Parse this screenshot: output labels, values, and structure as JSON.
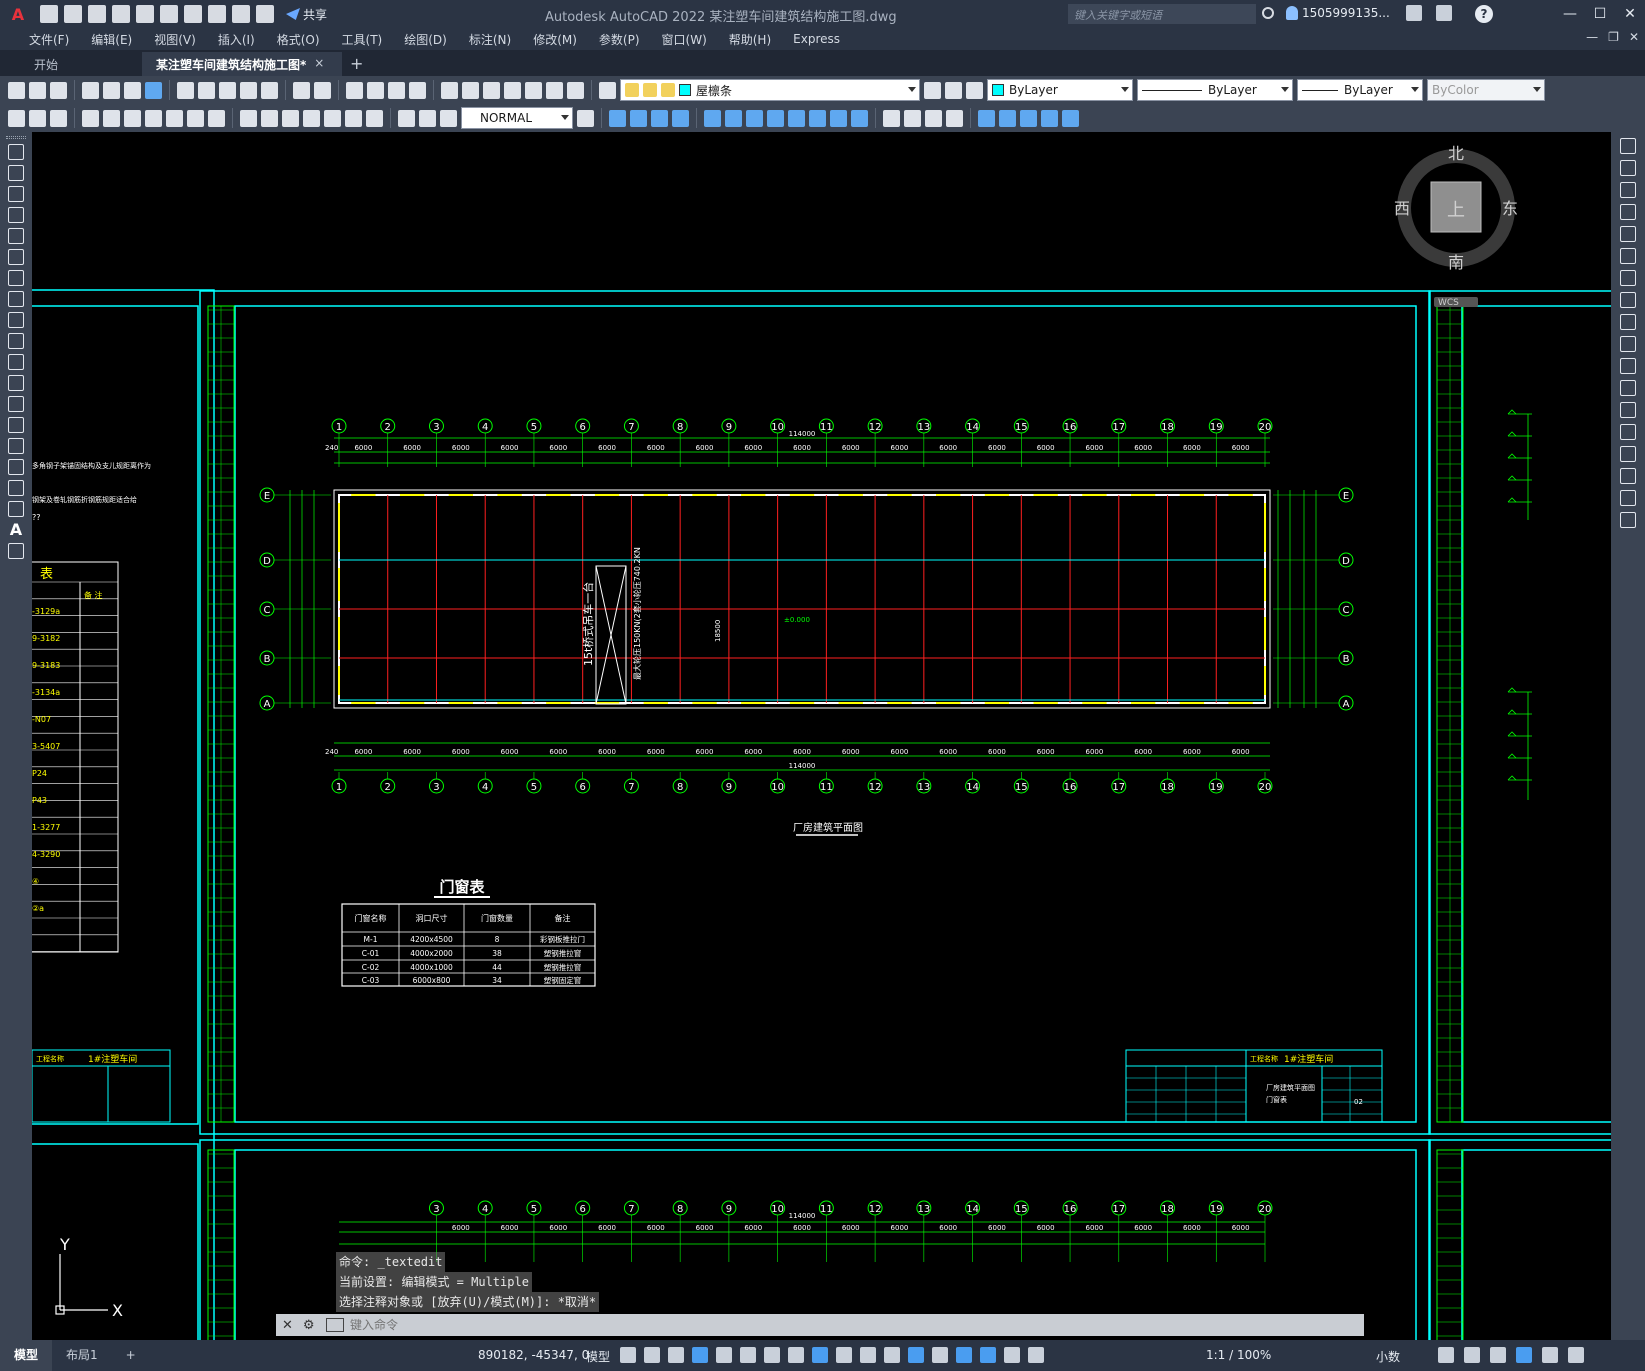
{
  "app": {
    "title": "Autodesk AutoCAD 2022    某注塑车间建筑结构施工图.dwg",
    "logo": "A",
    "share_label": "共享",
    "search_placeholder": "键入关键字或短语",
    "user": "1505999135...",
    "window_controls": [
      "—",
      "☐",
      "✕"
    ]
  },
  "menus": [
    "文件(F)",
    "编辑(E)",
    "视图(V)",
    "插入(I)",
    "格式(O)",
    "工具(T)",
    "绘图(D)",
    "标注(N)",
    "修改(M)",
    "参数(P)",
    "窗口(W)",
    "帮助(H)",
    "Express"
  ],
  "mdi_controls": [
    "—",
    "❐",
    "✕"
  ],
  "tabs": {
    "start": "开始",
    "active": "某注塑车间建筑结构施工图*",
    "close": "×",
    "new": "+"
  },
  "toolbar": {
    "layer": "屋檩条",
    "color": "ByLayer",
    "linetype": "ByLayer",
    "lineweight": "ByLayer",
    "plotstyle": "ByColor",
    "dimstyle": "NORMAL"
  },
  "viewcube": {
    "north": "北",
    "south": "南",
    "east": "东",
    "west": "西",
    "face": "上",
    "wcs": "WCS"
  },
  "ucs": {
    "x": "X",
    "y": "Y"
  },
  "drawing": {
    "plan_title": "厂房建筑平面图",
    "total_length": "114000",
    "bay": "6000",
    "side_dim": "240",
    "axis_numbers": [
      "1",
      "2",
      "3",
      "4",
      "5",
      "6",
      "7",
      "8",
      "9",
      "10",
      "11",
      "12",
      "13",
      "14",
      "15",
      "16",
      "17",
      "18",
      "19",
      "20"
    ],
    "axis_letters": [
      "E",
      "D",
      "C",
      "B",
      "A"
    ],
    "crane_note": "15t桥式吊车一台",
    "crane_load": "最大轮压150KN(2套小轮压740.2KN",
    "elevation": "±0.000",
    "span_label": "18500",
    "door_table": {
      "title": "门窗表",
      "headers": [
        "门窗名称",
        "洞口尺寸",
        "门窗数量",
        "备注"
      ],
      "rows": [
        [
          "M-1",
          "4200x4500",
          "8",
          "彩钢板推拉门"
        ],
        [
          "C-01",
          "4000x2000",
          "38",
          "塑钢推拉窗"
        ],
        [
          "C-02",
          "4000x1000",
          "44",
          "塑钢推拉窗"
        ],
        [
          "C-03",
          "6000x800",
          "34",
          "塑钢固定窗"
        ]
      ]
    },
    "title_block": {
      "project_label": "工程名称",
      "project": "1#注塑车间",
      "drawing_name": "厂房建筑平面图",
      "sub": "门窗表",
      "number": "02"
    },
    "left_table_title": "表",
    "left_table_note": "备 注",
    "left_codes": [
      "-3129a",
      "9-3182",
      "9-3183",
      "-3134a",
      "-N07",
      "3-5407",
      "P24",
      "P43",
      "1-3277",
      "4-3290",
      "④",
      "②a"
    ],
    "left_notes": [
      "多角钢子架锚固结构及支儿规距离作为",
      "钢架及卷轧钢筋折钢筋规距适合给",
      "??"
    ],
    "left_block_project": "1#注塑车间"
  },
  "command": {
    "history": [
      "命令: _textedit",
      "当前设置: 编辑模式 = Multiple",
      "选择注释对象或 [放弃(U)/模式(M)]: *取消*"
    ],
    "placeholder": "键入命令"
  },
  "status": {
    "tab_model": "模型",
    "tab_layout": "布局1",
    "tab_add": "+",
    "coords": "890182, -45347, 0",
    "space": "模型",
    "scale": "1:1 / 100%",
    "units": "小数"
  }
}
